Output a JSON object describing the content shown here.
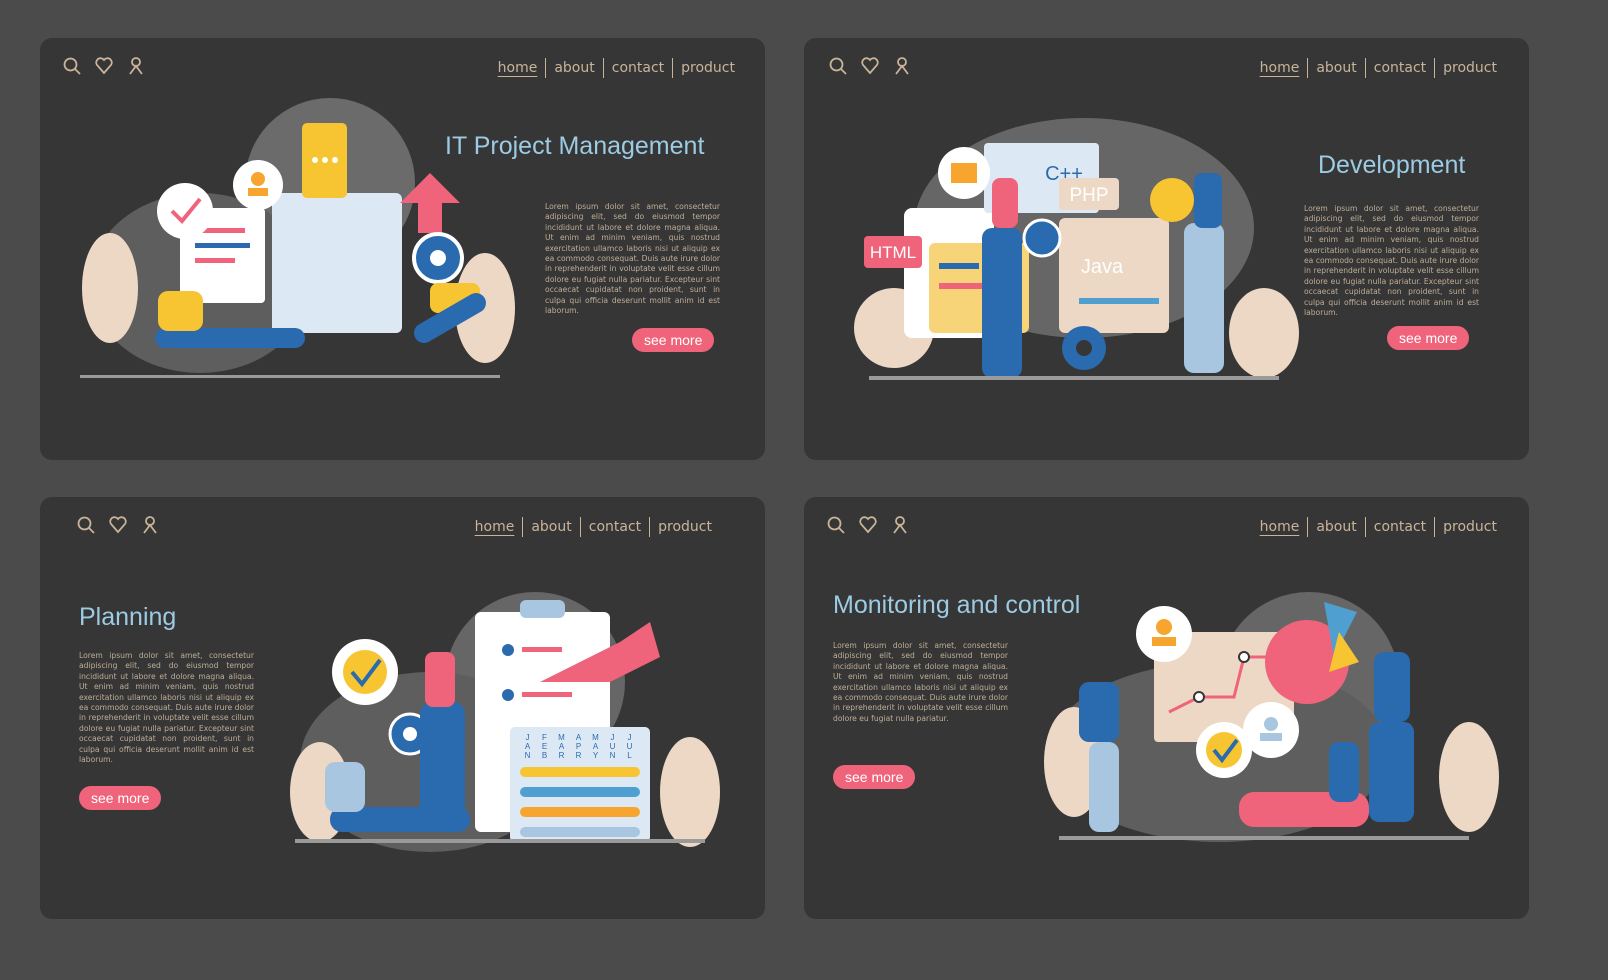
{
  "nav": {
    "items": [
      "home",
      "about",
      "contact",
      "product"
    ],
    "active": "home"
  },
  "icons": [
    "search-icon",
    "heart-icon",
    "user-icon"
  ],
  "colors": {
    "background": "#4b4b4b",
    "card": "#363636",
    "accent": "#f0647b",
    "title": "#9ccbe3",
    "nav": "#c9b49a",
    "yellow": "#f7c531",
    "blue": "#2a6bb0"
  },
  "lorem_full": "Lorem ipsum dolor sit amet, consectetur adipiscing elit, sed do eiusmod tempor incididunt ut labore et dolore magna aliqua. Ut enim ad minim veniam, quis nostrud exercitation ullamco laboris nisi ut aliquip ex ea commodo consequat. Duis aute irure dolor in reprehenderit in voluptate velit esse cillum dolore eu fugiat nulla pariatur. Excepteur sint occaecat cupidatat non proident, sunt in culpa qui officia deserunt mollit anim id est laborum.",
  "lorem_short": "Lorem ipsum dolor sit amet, consectetur adipiscing elit, sed do eiusmod tempor incididunt ut labore et dolore magna aliqua. Ut enim ad minim veniam, quis nostrud exercitation ullamco laboris nisi ut aliquip ex ea commodo consequat. Duis aute irure dolor in reprehenderit in voluptate velit esse cillum dolore eu fugiat nulla pariatur.",
  "cards": [
    {
      "title": "IT Project Management",
      "button": "see more"
    },
    {
      "title": "Development",
      "button": "see more",
      "code_labels": [
        "C++",
        "PHP",
        "HTML",
        "Java"
      ]
    },
    {
      "title": "Planning",
      "button": "see more",
      "months": [
        "JAN",
        "FEB",
        "MAR",
        "APR",
        "MAY",
        "JUN",
        "JUL"
      ]
    },
    {
      "title": "Monitoring and control",
      "button": "see more"
    }
  ]
}
